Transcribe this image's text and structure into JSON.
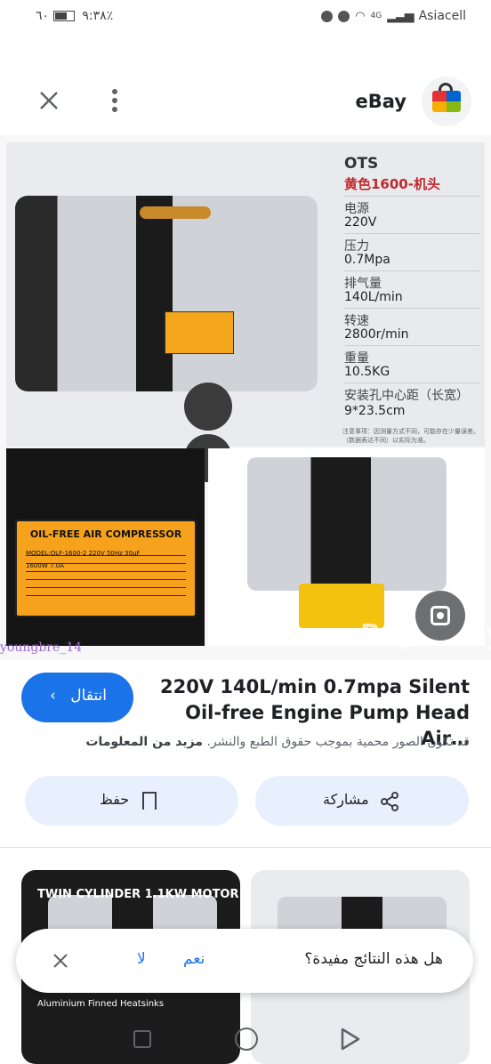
{
  "status_bar": {
    "time": "٩:٣٨",
    "battery": "٦٠٪",
    "carrier": "Asiacell",
    "network": "4G"
  },
  "top_bar": {
    "site_name": "eBay",
    "logo_colors": [
      "#e53238",
      "#0064d2",
      "#f5af02",
      "#86b817"
    ]
  },
  "product_image": {
    "spec_panel": {
      "brand": "OTS",
      "model": "黄色1600-机头",
      "rows": [
        {
          "key": "电源",
          "value": "220V"
        },
        {
          "key": "压力",
          "value": "0.7Mpa"
        },
        {
          "key": "排气量",
          "value": "140L/min"
        },
        {
          "key": "转速",
          "value": "2800r/min"
        },
        {
          "key": "重量",
          "value": "10.5KG"
        },
        {
          "key": "安装孔中心距（长宽）",
          "value": "9*23.5cm"
        }
      ],
      "note": "注意事项：因测量方式不同，可能存在少量误差。（数据表达不同）以实际为准。"
    },
    "nameplate": {
      "title": "OIL-FREE AIR COMPRESSOR",
      "model": "MODEL:OLF-1600-2  220V  50Hz  30μF",
      "power": "1600W  7.0A"
    },
    "bottom_left_label": "TWIN CYLINDER 1.1KW MOTOR",
    "watermark_left": "youngbre_14",
    "watermark_right": "Buyready"
  },
  "result": {
    "title": "220V 140L/min 0.7mpa Silent Oil-free Engine Pump Head Air…",
    "visit_label": "انتقال",
    "copyright_text": "قد تكون الصور محمية بموجب حقوق الطبع والنشر.",
    "more_info": "مزيد من المعلومات",
    "share_label": "مشاركة",
    "save_label": "حفظ"
  },
  "related": {
    "left_title": "TWIN CYLINDER 1.1KW MOTOR",
    "left_sub": "Aluminium Finned Heatsinks"
  },
  "feedback": {
    "question": "هل هذه النتائج مفيدة؟",
    "yes": "نعم",
    "no": "لا"
  },
  "colors": {
    "accent": "#1a73e8",
    "pill_bg": "#e8f0fe"
  }
}
